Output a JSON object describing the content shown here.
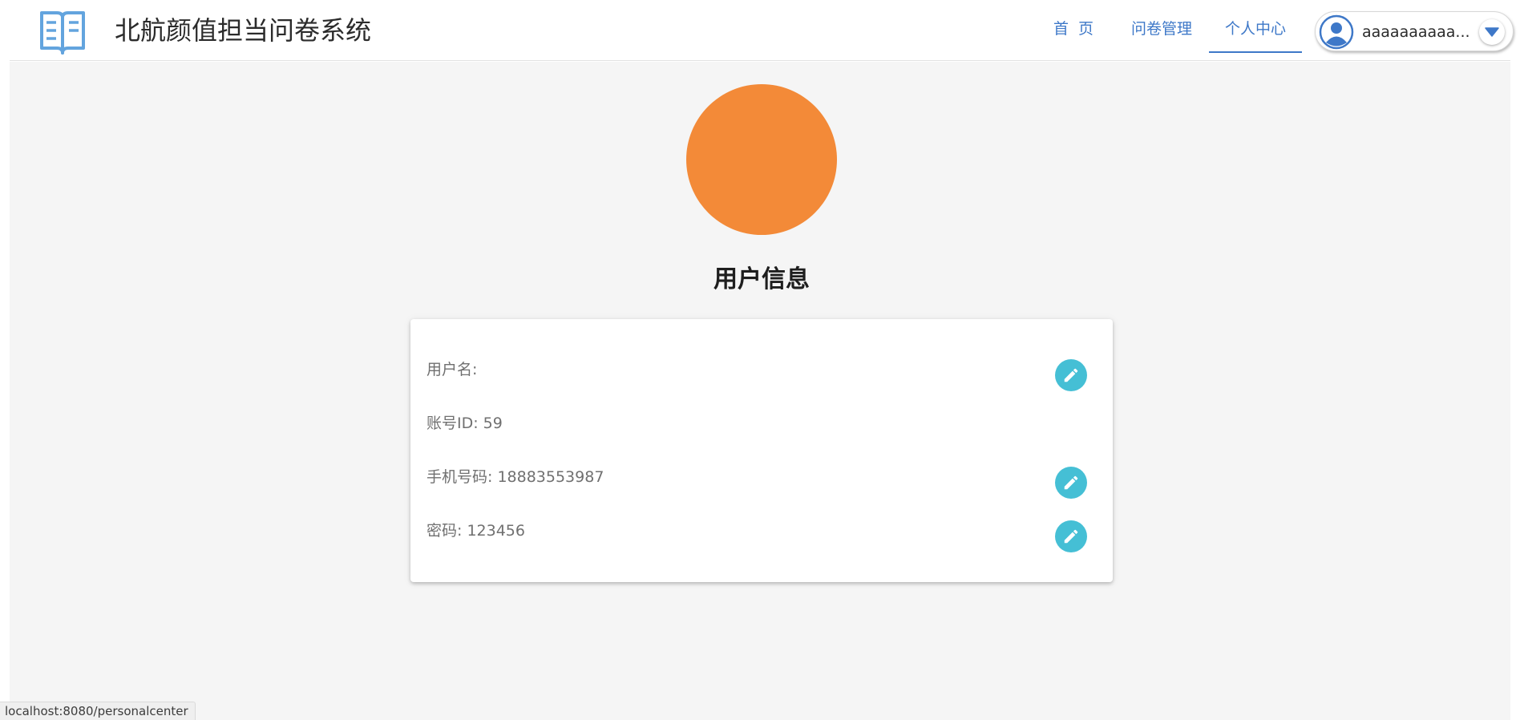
{
  "app": {
    "title": "北航颜值担当问卷系统",
    "logo_icon": "book-icon",
    "accent_color": "#3e78c8"
  },
  "nav": {
    "home": "首  页",
    "manage": "问卷管理",
    "personal": "个人中心",
    "active": "个人中心"
  },
  "user_menu": {
    "name": "aaaaaaaaaa...",
    "avatar_icon": "user-avatar-icon",
    "toggle_icon": "caret-down-icon"
  },
  "profile": {
    "avatar_color": "#f38a38",
    "section_title": "用户信息",
    "fields": {
      "username": "用户名:",
      "account_id": "账号ID: 59",
      "phone": "手机号码: 18883553987",
      "password": "密码: 123456"
    },
    "edit_icon": "pencil-icon",
    "edit_color": "#45bfd5"
  },
  "status_bar": {
    "url": "localhost:8080/personalcenter"
  }
}
